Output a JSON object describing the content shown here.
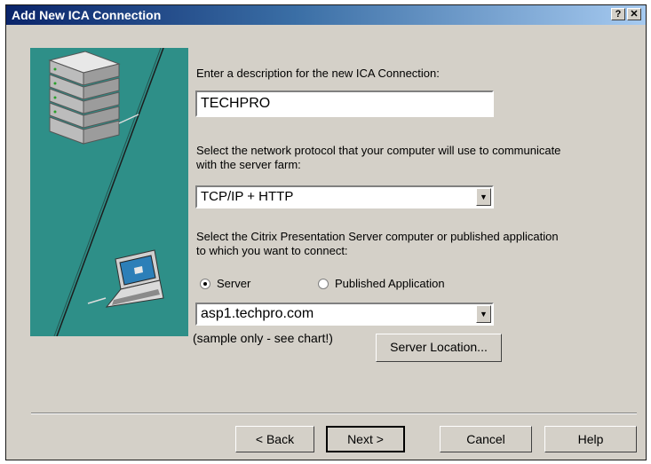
{
  "window": {
    "title": "Add New ICA Connection"
  },
  "titlebar_buttons": {
    "help_glyph": "?",
    "close_glyph": "✕"
  },
  "description": {
    "label": "Enter a description for the new ICA Connection:",
    "value": "TECHPRO"
  },
  "protocol": {
    "label": "Select the network protocol that your computer will use to communicate with the server farm:",
    "selected": "TCP/IP + HTTP"
  },
  "target": {
    "label": "Select the Citrix Presentation Server computer or published application to which you want to connect:",
    "options": [
      {
        "label": "Server",
        "selected": true
      },
      {
        "label": "Published Application",
        "selected": false
      }
    ],
    "server_value": "asp1.techpro.com",
    "note": "(sample only - see chart!)",
    "server_location_button": "Server Location..."
  },
  "buttons": {
    "back": "< Back",
    "next": "Next >",
    "cancel": "Cancel",
    "help": "Help"
  },
  "colors": {
    "panel": "#d4d0c8",
    "graphic": "#2e8f88",
    "titlebar": "#0a246a"
  }
}
